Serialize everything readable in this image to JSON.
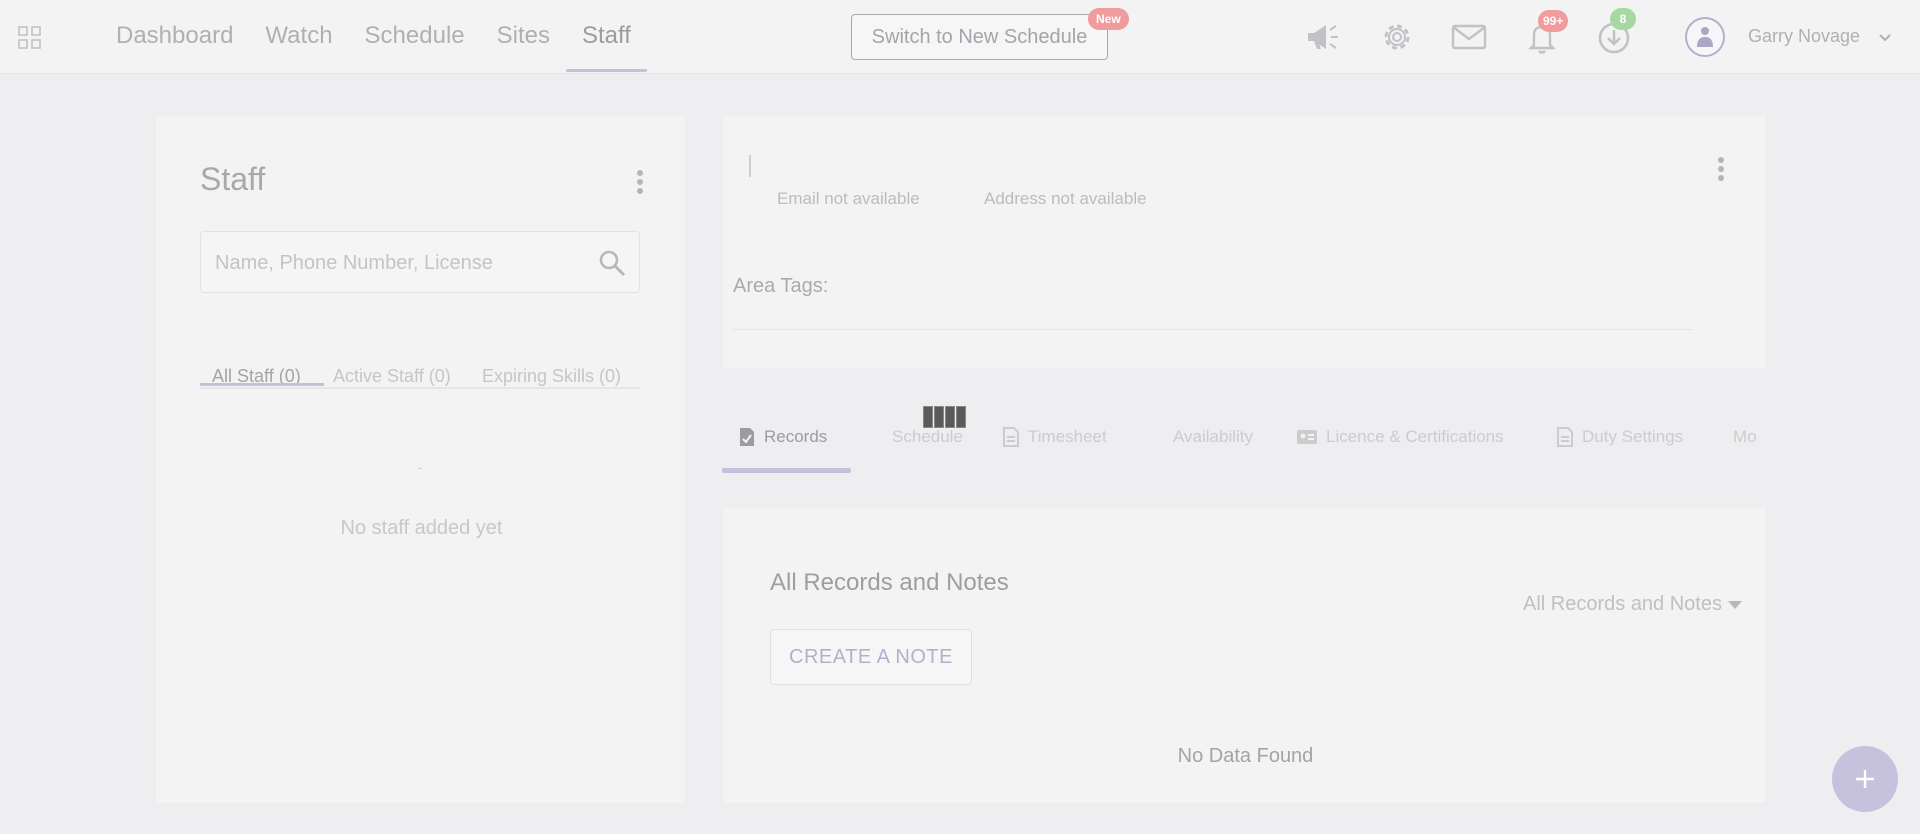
{
  "header": {
    "nav": [
      "Dashboard",
      "Watch",
      "Schedule",
      "Sites",
      "Staff"
    ],
    "switch_button": "Switch to New Schedule",
    "new_badge": "New",
    "notifications_count": "99+",
    "downloads_count": "8",
    "user_name": "Garry Novage",
    "icons": [
      "apps-grid-icon",
      "megaphone-icon",
      "gear-icon",
      "mail-icon",
      "bell-icon",
      "download-icon",
      "user-avatar-icon",
      "chevron-down-icon"
    ]
  },
  "staff_panel": {
    "title": "Staff",
    "search_placeholder": "Name, Phone Number, License",
    "tabs": [
      "All Staff (0)",
      "Active Staff (0)",
      "Expiring Skills (0)"
    ],
    "empty_mark": "-",
    "empty_text": "No staff added yet"
  },
  "profile": {
    "email": "Email not available",
    "address": "Address not available",
    "area_tags_label": "Area Tags:"
  },
  "profile_tabs": [
    "Records",
    "Schedule",
    "Timesheet",
    "Availability",
    "Licence & Certifications",
    "Duty Settings",
    "Mo"
  ],
  "records": {
    "title": "All Records and Notes",
    "filter_label": "All Records and Notes",
    "create_button": "CREATE A NOTE",
    "empty_text": "No Data Found"
  },
  "colors": {
    "accent": "#c4c0dc",
    "badge_red": "#f09c9c",
    "badge_green": "#a7d8a3",
    "background": "#eeeef0"
  }
}
